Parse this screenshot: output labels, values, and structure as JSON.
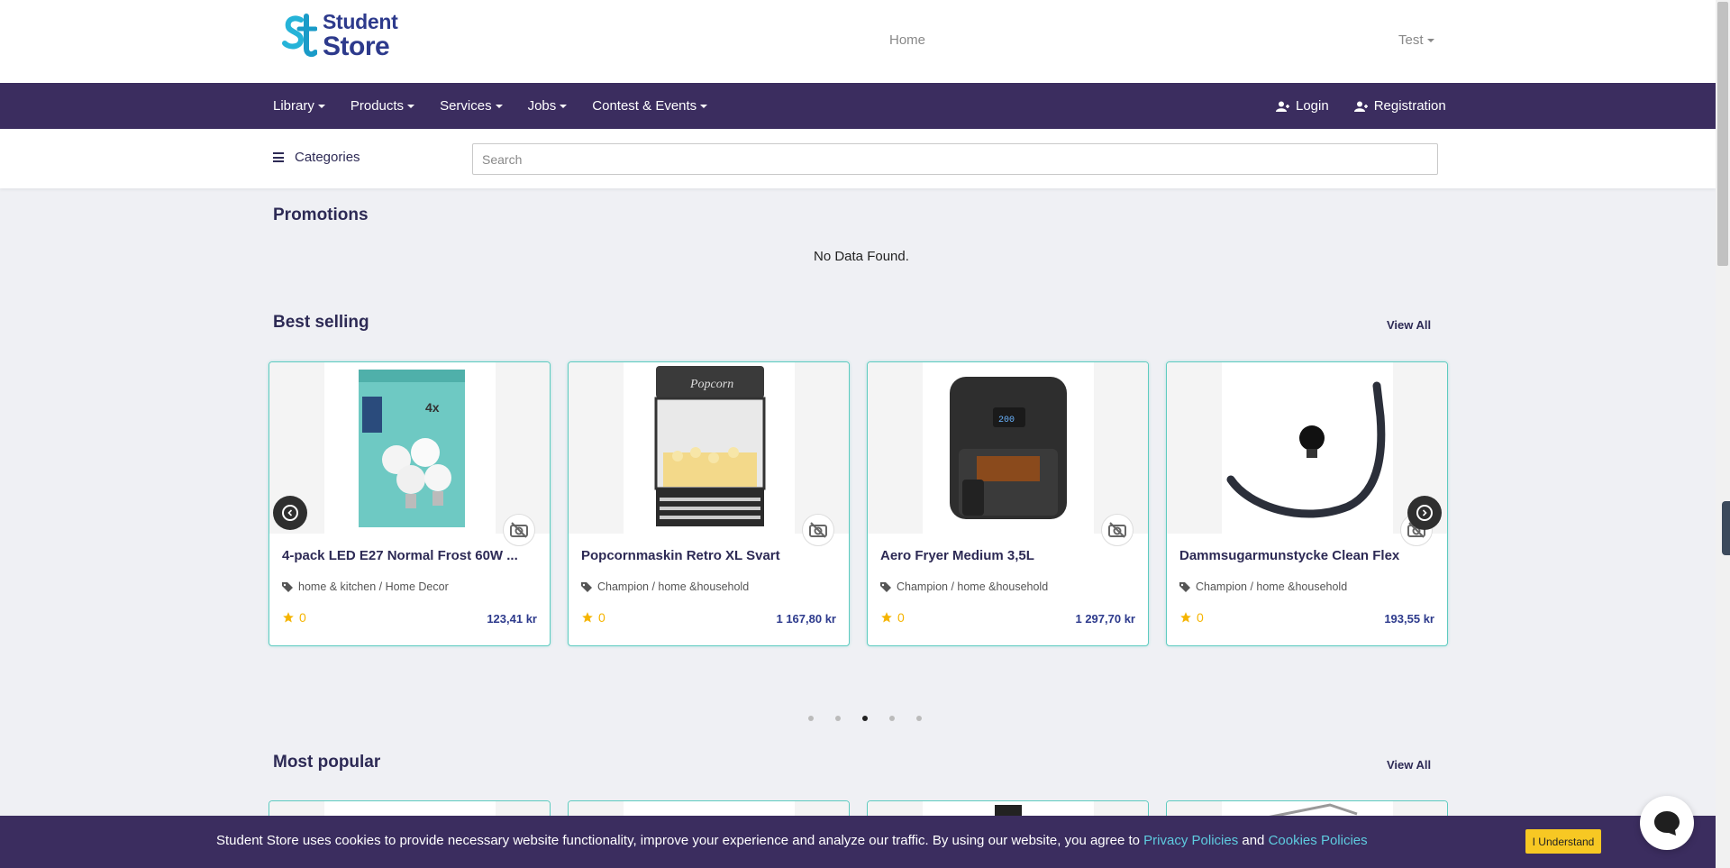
{
  "brand": {
    "line1": "Student",
    "line2": "Store"
  },
  "header": {
    "home_label": "Home",
    "user_label": "Test"
  },
  "nav": {
    "items": [
      "Library",
      "Products",
      "Services",
      "Jobs",
      "Contest & Events"
    ],
    "login_label": "Login",
    "registration_label": "Registration"
  },
  "search": {
    "categories_label": "Categories",
    "placeholder": "Search"
  },
  "promotions": {
    "title": "Promotions",
    "empty_text": "No Data Found."
  },
  "best_selling": {
    "title": "Best selling",
    "view_all": "View All",
    "products": [
      {
        "name": "4-pack LED E27 Normal Frost 60W ...",
        "category": "home & kitchen / Home Decor",
        "rating": "0",
        "price": "123,41 kr"
      },
      {
        "name": "Popcornmaskin Retro XL Svart",
        "category": "Champion / home &household",
        "rating": "0",
        "price": "1 167,80 kr"
      },
      {
        "name": "Aero Fryer Medium 3,5L",
        "category": "Champion / home &household",
        "rating": "0",
        "price": "1 297,70 kr"
      },
      {
        "name": "Dammsugarmunstycke Clean Flex",
        "category": "Champion / home &household",
        "rating": "0",
        "price": "193,55 kr"
      }
    ],
    "page_count": 5,
    "active_page": 3
  },
  "most_popular": {
    "title": "Most popular",
    "view_all": "View All"
  },
  "cookie": {
    "text": "Student Store uses cookies to provide necessary website functionality, improve your experience and analyze our traffic. By using our website, you agree to ",
    "privacy_link": "Privacy Policies",
    "and_text": " and ",
    "cookies_link": "Cookies Policies",
    "button_label": "I Understand"
  },
  "colors": {
    "brand_purple": "#3b2d5f",
    "accent_teal": "#5ecbc0",
    "star": "#f5b400",
    "cookie_button": "#f7c823"
  }
}
